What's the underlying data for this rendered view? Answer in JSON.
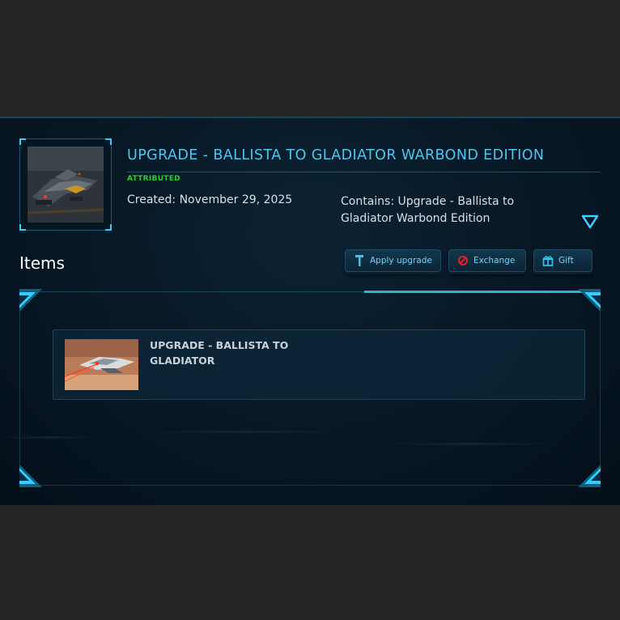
{
  "pledge": {
    "title": "UPGRADE - BALLISTA TO GLADIATOR WARBOND EDITION",
    "status": "ATTRIBUTED",
    "created": "Created: November 29, 2025",
    "contains": "Contains: Upgrade - Ballista to Gladiator Warbond Edition"
  },
  "items_section": {
    "heading": "Items"
  },
  "actions": {
    "apply_upgrade": "Apply upgrade",
    "exchange": "Exchange",
    "gift": "Gift"
  },
  "items": [
    {
      "name": "UPGRADE - BALLISTA TO GLADIATOR"
    }
  ],
  "colors": {
    "accent": "#4dc7ef",
    "status_green": "#21d52c",
    "panel_bg": "#071724",
    "outer_bg": "#252525",
    "exchange_red": "#e5212a"
  },
  "icons": {
    "apply_upgrade": "hammer-icon",
    "exchange": "prohibited-icon",
    "gift": "gift-icon",
    "toggle": "chevron-down-icon"
  }
}
